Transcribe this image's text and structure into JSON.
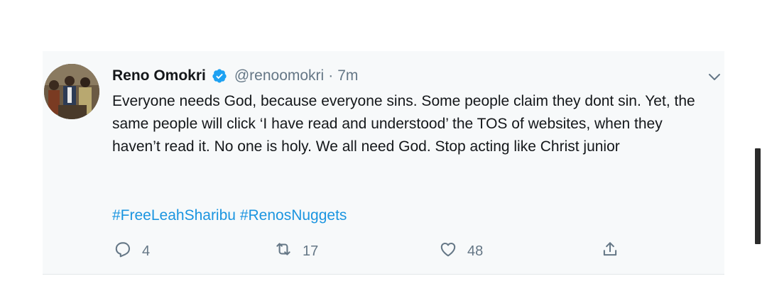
{
  "tweet": {
    "author_name": "Reno Omokri",
    "handle": "@renoomokri",
    "separator": "·",
    "time": "7m",
    "text": "Everyone needs God, because everyone sins. Some people claim they dont sin. Yet, the same people will click ‘I have read and understood’ the TOS of websites, when they haven’t read it. No one is holy. We all need God. Stop acting like Christ junior",
    "hashtags": [
      "#FreeLeahSharibu",
      "#RenosNuggets"
    ],
    "actions": {
      "reply_count": "4",
      "retweet_count": "17",
      "like_count": "48"
    },
    "icons": {
      "verified": "verified-badge-icon",
      "caret": "chevron-down-icon",
      "reply": "reply-icon",
      "retweet": "retweet-icon",
      "like": "heart-icon",
      "share": "share-icon"
    }
  },
  "colors": {
    "accent": "#1da1f2",
    "hashtag": "#1b95e0",
    "secondary_text": "#657786",
    "primary_text": "#14171a",
    "card_background": "#f7f9fa"
  }
}
